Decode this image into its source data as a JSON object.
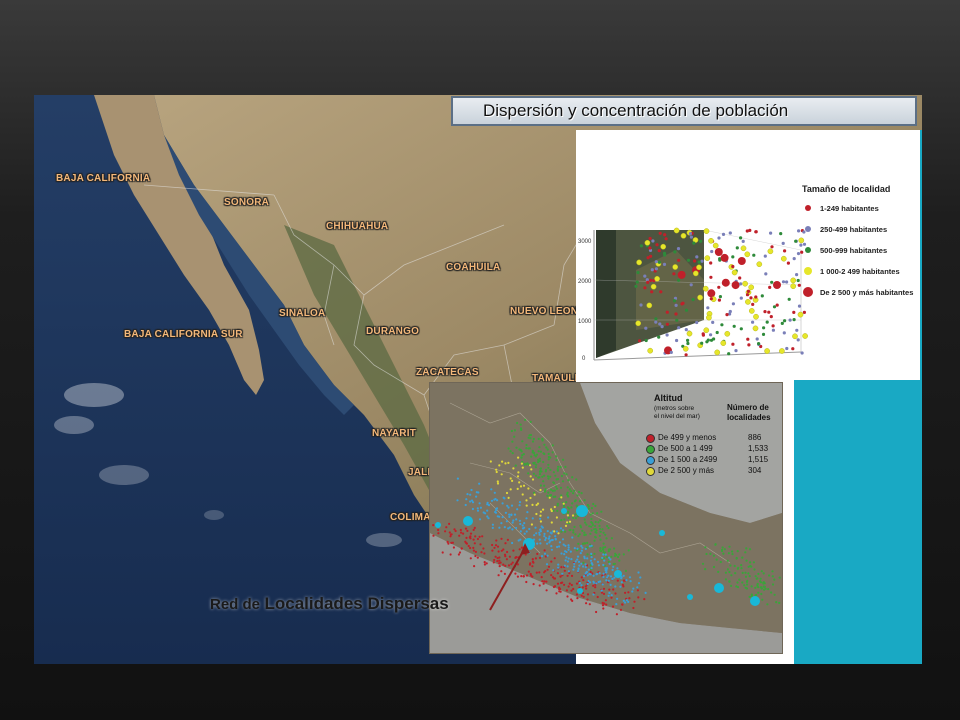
{
  "title": "Dispersión y concentración de población",
  "map_labels": {
    "baja_california": "BAJA CALIFORNIA",
    "sonora": "SONORA",
    "chihuahua": "CHIHUAHUA",
    "coahuila": "COAHUILA",
    "nuevo_leon": "NUEVO LEON",
    "sinaloa": "SINALOA",
    "durango": "DURANGO",
    "baja_california_sur": "BAJA CALIFORNIA SUR",
    "zacatecas": "ZACATECAS",
    "tamaulipas": "TAMAULI",
    "nayarit": "NAYARIT",
    "jalisco": "JALIS",
    "colima": "COLIMA"
  },
  "scatter_legend": {
    "title": "Tamaño de localidad",
    "items": [
      {
        "label": "1-249 habitantes",
        "color": "#c0202a"
      },
      {
        "label": "250-499 habitantes",
        "color": "#7a7fb8"
      },
      {
        "label": "500-999 habitantes",
        "color": "#2e8a3a"
      },
      {
        "label": "1 000-2 499 habitantes",
        "color": "#e6e62a"
      },
      {
        "label": "De 2 500 y más habitantes",
        "color": "#c0202a"
      }
    ],
    "axis_ticks": [
      "3000",
      "2000",
      "1000",
      "0"
    ]
  },
  "altitude_legend": {
    "col1_title": "Altitud",
    "col1_sub": [
      "(metros sobre",
      "el nivel del mar)"
    ],
    "col2_title": [
      "Número de",
      "localidades"
    ],
    "items": [
      {
        "label": "De 499 y menos",
        "count": "886",
        "color": "#c0202a"
      },
      {
        "label": "De 500 a 1 499",
        "count": "1,533",
        "color": "#3aa53a"
      },
      {
        "label": "De 1 500 a 2499",
        "count": "1,515",
        "color": "#3a9fd6"
      },
      {
        "label": "De 2 500 y más",
        "count": "304",
        "color": "#e0d83a"
      }
    ]
  },
  "caption": {
    "part1": "Red de",
    "part2": "Localidades Dispersas"
  },
  "colors": {
    "teal": "#19a9c4",
    "title_border": "#5b6f86"
  }
}
